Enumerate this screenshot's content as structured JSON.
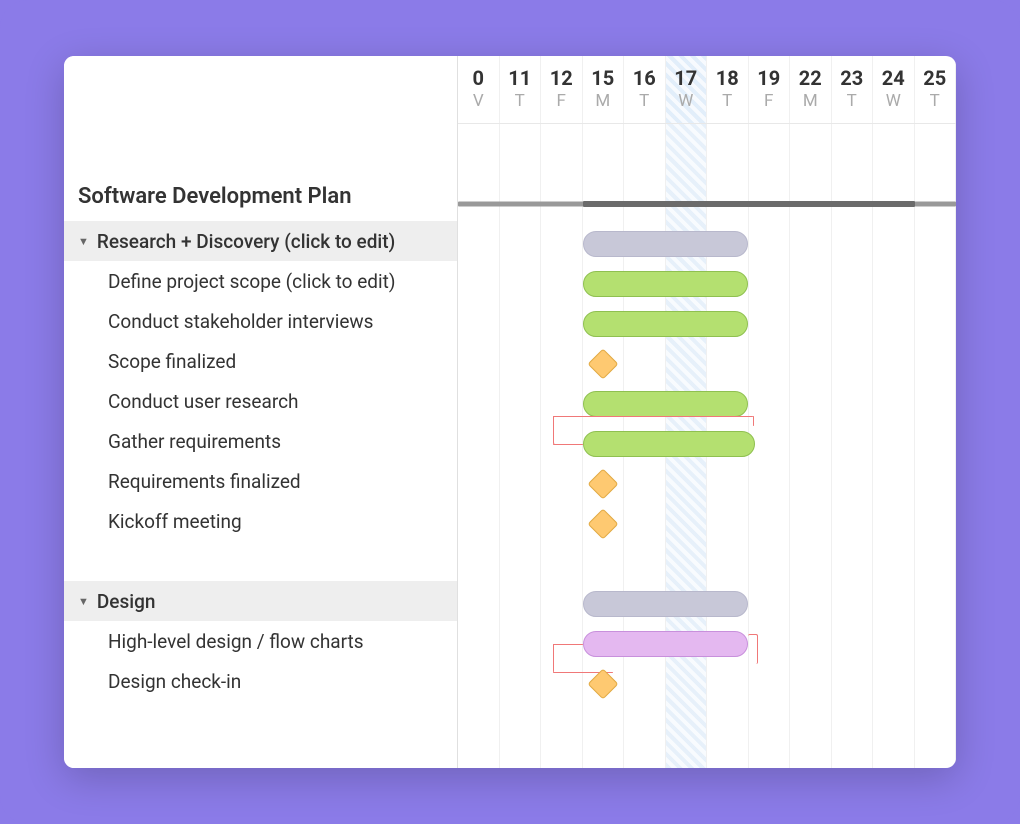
{
  "plan_title": "Software Development Plan",
  "timeline": {
    "today_index": 5,
    "columns": [
      {
        "num": "0",
        "letter": "V"
      },
      {
        "num": "11",
        "letter": "T"
      },
      {
        "num": "12",
        "letter": "F"
      },
      {
        "num": "15",
        "letter": "M"
      },
      {
        "num": "16",
        "letter": "T"
      },
      {
        "num": "17",
        "letter": "W"
      },
      {
        "num": "18",
        "letter": "T"
      },
      {
        "num": "19",
        "letter": "F"
      },
      {
        "num": "22",
        "letter": "M"
      },
      {
        "num": "23",
        "letter": "T"
      },
      {
        "num": "24",
        "letter": "W"
      },
      {
        "num": "25",
        "letter": "T"
      }
    ]
  },
  "groups": [
    {
      "name": "Research + Discovery (click to edit)",
      "tasks": [
        {
          "label": "Define project scope (click to edit)",
          "type": "bar",
          "color": "green",
          "start": 3,
          "end": 7
        },
        {
          "label": "Conduct stakeholder interviews",
          "type": "bar",
          "color": "green",
          "start": 3,
          "end": 7
        },
        {
          "label": "Scope finalized",
          "type": "milestone",
          "at": 3.5
        },
        {
          "label": "Conduct user research",
          "type": "bar",
          "color": "green",
          "start": 3,
          "end": 7
        },
        {
          "label": "Gather requirements",
          "type": "bar",
          "color": "green",
          "start": 3,
          "end": 7,
          "dep_from": 2.3
        },
        {
          "label": "Requirements finalized",
          "type": "milestone",
          "at": 3.5
        },
        {
          "label": "Kickoff meeting",
          "type": "milestone",
          "at": 3.5
        }
      ],
      "summary": {
        "start": 3,
        "end": 7
      }
    },
    {
      "name": "Design",
      "tasks": [
        {
          "label": "High-level design / flow charts",
          "type": "bar",
          "color": "purple",
          "start": 3,
          "end": 7,
          "dep_from": 2.3
        },
        {
          "label": "Design check-in",
          "type": "milestone",
          "at": 3.5
        }
      ],
      "summary": {
        "start": 3,
        "end": 7
      }
    }
  ],
  "colors": {
    "accent_bg": "#8b7be8",
    "green_bar": "#b4e070",
    "purple_bar": "#e4b8f0",
    "milestone": "#fec971",
    "dependency": "#f07878",
    "summary_pill": "#c8c8d8"
  }
}
